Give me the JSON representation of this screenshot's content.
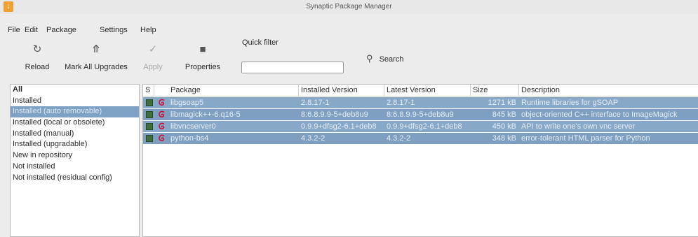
{
  "window": {
    "title": "Synaptic Package Manager"
  },
  "menu": [
    {
      "label": "File"
    },
    {
      "label": "Edit"
    },
    {
      "label": "Package"
    },
    {
      "label": "Settings"
    },
    {
      "label": "Help"
    }
  ],
  "toolbar": {
    "reload": "Reload",
    "mark_all_upgrades": "Mark All Upgrades",
    "apply": "Apply",
    "properties": "Properties",
    "quick_filter_label": "Quick filter",
    "quick_filter_value": "",
    "search": "Search"
  },
  "icons": {
    "app": "synaptic-app-icon",
    "reload": "reload-icon",
    "mark_all_upgrades": "upgrade-arrow-icon",
    "apply": "checkmark-icon",
    "properties": "properties-icon",
    "search": "search-icon",
    "package": "debian-swirl-icon"
  },
  "colors": {
    "selection": "#88a8c8",
    "status_installed": "#3f6e3b",
    "debian": "#c8103c"
  },
  "filters": [
    {
      "label": "All",
      "header": true
    },
    {
      "label": "Installed"
    },
    {
      "label": "Installed (auto removable)",
      "selected": true
    },
    {
      "label": "Installed (local or obsolete)"
    },
    {
      "label": "Installed (manual)"
    },
    {
      "label": "Installed (upgradable)"
    },
    {
      "label": "New in repository"
    },
    {
      "label": "Not installed"
    },
    {
      "label": "Not installed (residual config)"
    }
  ],
  "columns": {
    "status": "S",
    "package": "Package",
    "installed_version": "Installed Version",
    "latest_version": "Latest Version",
    "size": "Size",
    "description": "Description"
  },
  "packages": [
    {
      "name": "libgsoap5",
      "installed": "2.8.17-1",
      "latest": "2.8.17-1",
      "size": "1271 kB",
      "description": "Runtime libraries for gSOAP"
    },
    {
      "name": "libmagick++-6.q16-5",
      "installed": "8:6.8.9.9-5+deb8u9",
      "latest": "8:6.8.9.9-5+deb8u9",
      "size": "845 kB",
      "description": "object-oriented C++ interface to ImageMagick"
    },
    {
      "name": "libvncserver0",
      "installed": "0.9.9+dfsg2-6.1+deb8",
      "latest": "0.9.9+dfsg2-6.1+deb8",
      "size": "450 kB",
      "description": "API to write one's own vnc server"
    },
    {
      "name": "python-bs4",
      "installed": "4.3.2-2",
      "latest": "4.3.2-2",
      "size": "348 kB",
      "description": "error-tolerant HTML parser for Python"
    }
  ]
}
